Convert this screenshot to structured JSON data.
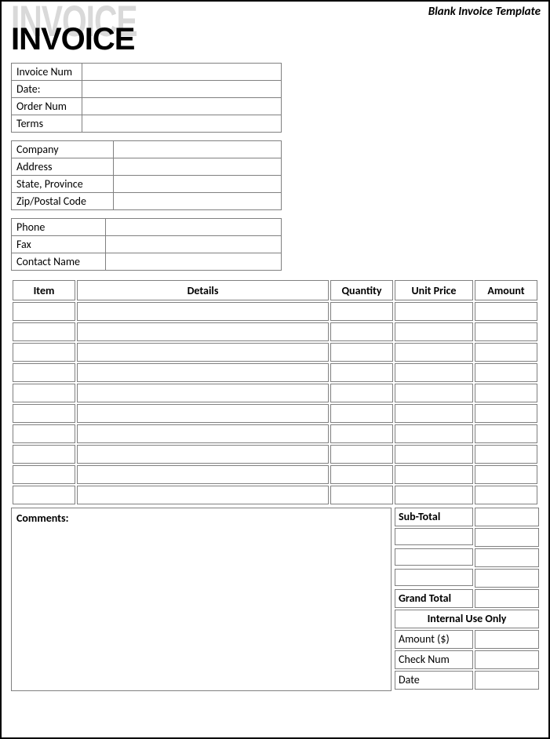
{
  "corner_label": "Blank Invoice Template",
  "logo_text": "INVOICE",
  "meta1": {
    "invoice_num": "Invoice Num",
    "date": "Date:",
    "order_num": "Order Num",
    "terms": "Terms"
  },
  "meta2": {
    "company": "Company",
    "address": "Address",
    "state": "State, Province",
    "zip": "Zip/Postal Code"
  },
  "meta3": {
    "phone": "Phone",
    "fax": "Fax",
    "contact": "Contact Name"
  },
  "items_header": {
    "item": "Item",
    "details": "Details",
    "quantity": "Quantity",
    "unit_price": "Unit Price",
    "amount": "Amount"
  },
  "comments_label": "Comments:",
  "totals": {
    "subtotal": "Sub-Total",
    "grand_total": "Grand Total",
    "internal_header": "Internal Use Only",
    "amount": "Amount ($)",
    "check_num": "Check Num",
    "date": "Date"
  }
}
